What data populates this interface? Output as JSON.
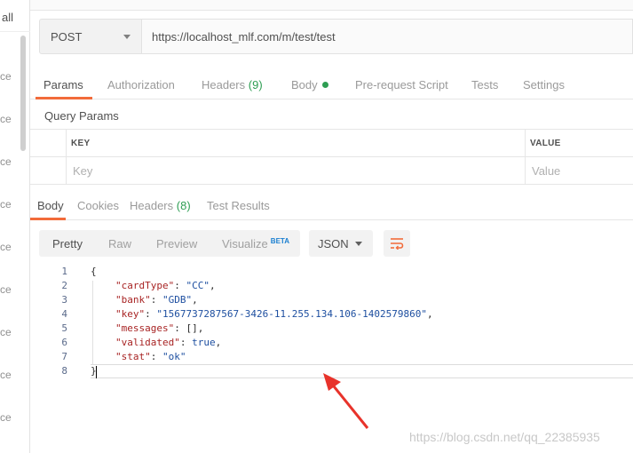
{
  "sidebar": {
    "header": "all",
    "items": [
      "ce",
      "ce",
      "ce",
      "ce",
      "ce",
      "ce",
      "ce",
      "ce",
      "ce"
    ]
  },
  "request": {
    "method": "POST",
    "url": "https://localhost_mlf.com/m/test/test"
  },
  "request_tabs": {
    "params": "Params",
    "authorization": "Authorization",
    "headers": "Headers",
    "headers_count": "(9)",
    "body": "Body",
    "prerequest": "Pre-request Script",
    "tests": "Tests",
    "settings": "Settings"
  },
  "query_params": {
    "title": "Query Params",
    "key_header": "KEY",
    "value_header": "VALUE",
    "key_placeholder": "Key",
    "value_placeholder": "Value"
  },
  "response_tabs": {
    "body": "Body",
    "cookies": "Cookies",
    "headers": "Headers",
    "headers_count": "(8)",
    "test_results": "Test Results"
  },
  "view": {
    "pretty": "Pretty",
    "raw": "Raw",
    "preview": "Preview",
    "visualize": "Visualize",
    "beta": "BETA",
    "format": "JSON"
  },
  "code_lines": [
    {
      "n": "1",
      "text": "{"
    },
    {
      "n": "2",
      "key": "\"cardType\"",
      "val": "\"CC\"",
      "trail": ","
    },
    {
      "n": "3",
      "key": "\"bank\"",
      "val": "\"GDB\"",
      "trail": ","
    },
    {
      "n": "4",
      "key": "\"key\"",
      "val": "\"1567737287567-3426-11.255.134.106-1402579860\"",
      "trail": ","
    },
    {
      "n": "5",
      "key": "\"messages\"",
      "val": "[]",
      "trail": ","
    },
    {
      "n": "6",
      "key": "\"validated\"",
      "val": "true",
      "trail": ","
    },
    {
      "n": "7",
      "key": "\"stat\"",
      "val": "\"ok\"",
      "trail": ""
    },
    {
      "n": "8",
      "text": "}"
    }
  ],
  "watermark": "https://blog.csdn.net/qq_22385935",
  "colors": {
    "accent": "#f26b3a",
    "count_green": "#2e9e53",
    "annotation_arrow": "#e8332b"
  }
}
